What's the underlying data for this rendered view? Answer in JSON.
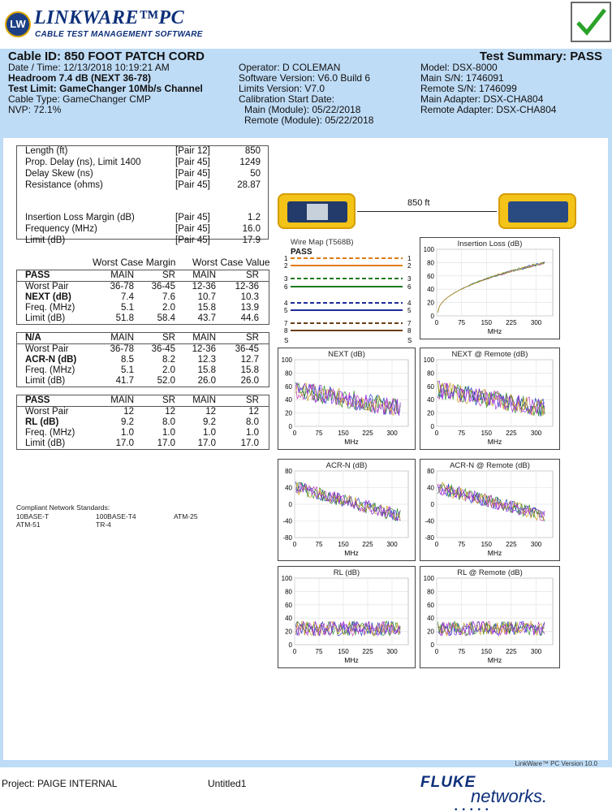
{
  "header": {
    "logo_badge": "LW",
    "app_title": "LINKWARE™PC",
    "app_subtitle": "CABLE TEST MANAGEMENT SOFTWARE"
  },
  "summary": {
    "cable_id": "Cable ID: 850 FOOT PATCH  CORD",
    "test_summary": "Test Summary: PASS",
    "left": [
      "Date / Time: 12/13/2018  10:19:21 AM",
      "Headroom 7.4 dB (NEXT 36-78)",
      "Test Limit: GameChanger 10Mb/s Channel",
      "Cable Type: GameChanger CMP",
      "NVP: 72.1%"
    ],
    "middle": [
      "Operator: D  COLEMAN",
      "Software Version: V6.0 Build 6",
      "Limits Version: V7.0",
      "Calibration Start Date:",
      "Main (Module): 05/22/2018",
      "Remote (Module): 05/22/2018"
    ],
    "right": [
      "Model: DSX-8000",
      "Main S/N: 1746091",
      "Remote S/N: 1746099",
      "Main Adapter: DSX-CHA804",
      "Remote Adapter: DSX-CHA804"
    ]
  },
  "measurements": [
    {
      "label": "Length (ft)",
      "pair": "[Pair 12]",
      "value": "850"
    },
    {
      "label": "Prop. Delay (ns), Limit 1400",
      "pair": "[Pair 45]",
      "value": "1249"
    },
    {
      "label": "Delay Skew (ns)",
      "pair": "[Pair 45]",
      "value": "50"
    },
    {
      "label": "Resistance (ohms)",
      "pair": "[Pair 45]",
      "value": "28.87"
    },
    {
      "label": "Insertion Loss Margin (dB)",
      "pair": "[Pair 45]",
      "value": "1.2"
    },
    {
      "label": "Frequency (MHz)",
      "pair": "[Pair 45]",
      "value": "16.0"
    },
    {
      "label": "Limit (dB)",
      "pair": "[Pair 45]",
      "value": "17.9"
    }
  ],
  "worst_case": {
    "margin_header": "Worst Case Margin",
    "value_header": "Worst Case Value"
  },
  "tables": [
    {
      "rows": [
        [
          "PASS",
          "MAIN",
          "SR",
          "MAIN",
          "SR"
        ],
        [
          "Worst Pair",
          "36-78",
          "36-45",
          "12-36",
          "12-36"
        ],
        [
          "NEXT (dB)",
          "7.4",
          "7.6",
          "10.7",
          "10.3"
        ],
        [
          "Freq. (MHz)",
          "5.1",
          "2.0",
          "15.8",
          "13.9"
        ],
        [
          "Limit (dB)",
          "51.8",
          "58.4",
          "43.7",
          "44.6"
        ]
      ]
    },
    {
      "rows": [
        [
          "N/A",
          "MAIN",
          "SR",
          "MAIN",
          "SR"
        ],
        [
          "Worst Pair",
          "36-78",
          "36-45",
          "12-36",
          "36-45"
        ],
        [
          "ACR-N (dB)",
          "8.5",
          "8.2",
          "12.3",
          "12.7"
        ],
        [
          "Freq. (MHz)",
          "5.1",
          "2.0",
          "15.8",
          "15.8"
        ],
        [
          "Limit (dB)",
          "41.7",
          "52.0",
          "26.0",
          "26.0"
        ]
      ]
    },
    {
      "rows": [
        [
          "PASS",
          "MAIN",
          "SR",
          "MAIN",
          "SR"
        ],
        [
          "Worst Pair",
          "12",
          "12",
          "12",
          "12"
        ],
        [
          "RL (dB)",
          "9.2",
          "8.0",
          "9.2",
          "8.0"
        ],
        [
          "Freq. (MHz)",
          "1.0",
          "1.0",
          "1.0",
          "1.0"
        ],
        [
          "Limit (dB)",
          "17.0",
          "17.0",
          "17.0",
          "17.0"
        ]
      ]
    }
  ],
  "standards": {
    "title": "Compliant Network Standards:",
    "items": [
      "10BASE-T",
      "100BASE-T4",
      "ATM-25",
      "ATM-51",
      "TR-4"
    ]
  },
  "cable_length_label": "850 ft",
  "wire_map": {
    "title": "Wire Map (T568B)",
    "result": "PASS",
    "pins": [
      "1",
      "2",
      "3",
      "6",
      "4",
      "5",
      "7",
      "8",
      "S"
    ],
    "colors": {
      "pair12": "#e07b12",
      "pair36": "#1d7a1d",
      "pair45": "#1c2c9a",
      "pair78": "#6b3f16"
    }
  },
  "graphs": [
    {
      "id": "insertion_loss",
      "title": "Insertion Loss (dB)",
      "xlabel": "MHz",
      "xticks": [
        "0",
        "75",
        "150",
        "225",
        "300"
      ],
      "yticks": [
        "0",
        "20",
        "40",
        "60",
        "80",
        "100"
      ]
    },
    {
      "id": "next",
      "title": "NEXT (dB)",
      "xlabel": "MHz",
      "xticks": [
        "0",
        "75",
        "150",
        "225",
        "300"
      ],
      "yticks": [
        "0",
        "20",
        "40",
        "60",
        "80",
        "100"
      ]
    },
    {
      "id": "next_remote",
      "title": "NEXT @ Remote (dB)",
      "xlabel": "MHz",
      "xticks": [
        "0",
        "75",
        "150",
        "225",
        "300"
      ],
      "yticks": [
        "0",
        "20",
        "40",
        "60",
        "80",
        "100"
      ]
    },
    {
      "id": "acrn",
      "title": "ACR-N (dB)",
      "xlabel": "MHz",
      "xticks": [
        "0",
        "75",
        "150",
        "225",
        "300"
      ],
      "yticks": [
        "-80",
        "-40",
        "0",
        "40",
        "80"
      ]
    },
    {
      "id": "acrn_remote",
      "title": "ACR-N @ Remote (dB)",
      "xlabel": "MHz",
      "xticks": [
        "0",
        "75",
        "150",
        "225",
        "300"
      ],
      "yticks": [
        "-80",
        "-40",
        "0",
        "40",
        "80"
      ]
    },
    {
      "id": "rl",
      "title": "RL (dB)",
      "xlabel": "MHz",
      "xticks": [
        "0",
        "75",
        "150",
        "225",
        "300"
      ],
      "yticks": [
        "0",
        "20",
        "40",
        "60",
        "80",
        "100"
      ]
    },
    {
      "id": "rl_remote",
      "title": "RL @ Remote (dB)",
      "xlabel": "MHz",
      "xticks": [
        "0",
        "75",
        "150",
        "225",
        "300"
      ],
      "yticks": [
        "0",
        "20",
        "40",
        "60",
        "80",
        "100"
      ]
    }
  ],
  "graph_colors": [
    "#1f3fbf",
    "#c23fb0",
    "#2a8a2a",
    "#c9a320",
    "#8a2be2",
    "#333333"
  ],
  "version_note": "LinkWare™ PC Version 10.0",
  "footer": {
    "project": "Project: PAIGE INTERNAL",
    "untitled": "Untitled1",
    "brand_top": "FLUKE",
    "brand_bottom": "networks."
  }
}
